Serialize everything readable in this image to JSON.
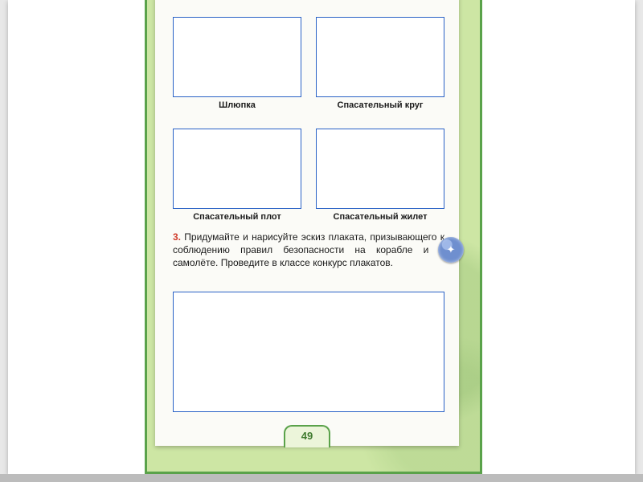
{
  "captions": {
    "a": "Шлюпка",
    "b": "Спасательный круг",
    "c": "Спасательный плот",
    "d": "Спасательный жилет"
  },
  "task": {
    "number": "3.",
    "text": "Придумайте и нарисуйте эскиз плаката, при­зывающего к соблюдению правил безопасности на корабле и в самолёте. Проведите в клас­се конкурс плакатов."
  },
  "page_number": "49",
  "badge_glyph": "✦"
}
